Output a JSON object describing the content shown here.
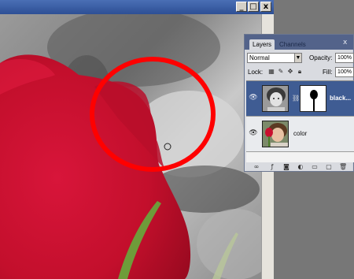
{
  "window": {
    "minimize_glyph": "_",
    "maximize_glyph": "□",
    "close_glyph": "x"
  },
  "layers_panel": {
    "tabs": [
      "Layers",
      "Channels"
    ],
    "close_glyph": "x",
    "blend_mode": "Normal",
    "opacity_label": "Opacity:",
    "opacity_value": "100%",
    "lock_label": "Lock:",
    "fill_label": "Fill:",
    "fill_value": "100%",
    "layers": [
      {
        "name": "black...",
        "selected": true,
        "has_mask": true,
        "eye_icon": "eye-icon",
        "chain_icon": "chain-link-icon"
      },
      {
        "name": "color",
        "selected": false,
        "has_mask": false,
        "eye_icon": "eye-icon"
      }
    ],
    "footer_icons": [
      "link-layers-icon",
      "layer-style-icon",
      "add-mask-icon",
      "adjustment-layer-icon",
      "new-group-icon",
      "new-layer-icon",
      "trash-icon"
    ]
  },
  "colors": {
    "rose_red": "#c8102e",
    "annotation_circle": "#ff0000",
    "selected_layer": "#3f5c93"
  }
}
